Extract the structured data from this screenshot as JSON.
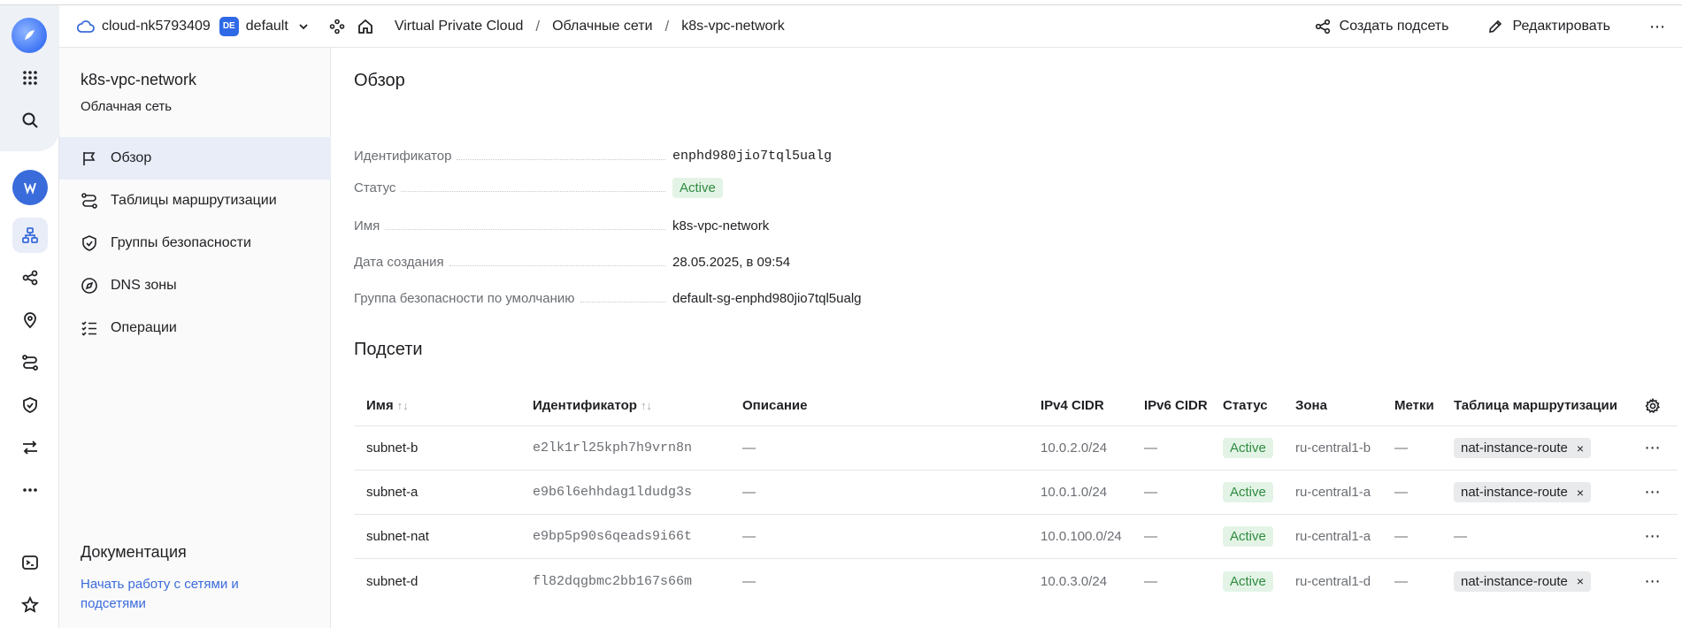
{
  "header": {
    "cloud_name": "cloud-nk5793409",
    "folder_badge": "DE",
    "folder_name": "default",
    "breadcrumb": [
      "Virtual Private Cloud",
      "Облачные сети",
      "k8s-vpc-network"
    ],
    "separator": "/",
    "create_subnet_label": "Создать подсеть",
    "edit_label": "Редактировать",
    "more_label": "⋯"
  },
  "sidebar": {
    "title": "k8s-vpc-network",
    "subtitle": "Облачная сеть",
    "items": [
      {
        "label": "Обзор",
        "icon": "flag-icon",
        "active": true
      },
      {
        "label": "Таблицы маршрутизации",
        "icon": "route-icon"
      },
      {
        "label": "Группы безопасности",
        "icon": "shield-icon"
      },
      {
        "label": "DNS зоны",
        "icon": "compass-icon"
      },
      {
        "label": "Операции",
        "icon": "list-check-icon"
      }
    ],
    "doc_title": "Документация",
    "doc_link": "Начать работу с сетями и подсетями"
  },
  "overview": {
    "title": "Обзор",
    "fields": {
      "id_label": "Идентификатор",
      "id_value": "enphd980jio7tql5ualg",
      "status_label": "Статус",
      "status_value": "Active",
      "name_label": "Имя",
      "name_value": "k8s-vpc-network",
      "created_label": "Дата создания",
      "created_value": "28.05.2025, в 09:54",
      "sg_label": "Группа безопасности по умолчанию",
      "sg_value": "default-sg-enphd980jio7tql5ualg"
    }
  },
  "subnets": {
    "title": "Подсети",
    "columns": [
      "Имя",
      "Идентификатор",
      "Описание",
      "IPv4 CIDR",
      "IPv6 CIDR",
      "Статус",
      "Зона",
      "Метки",
      "Таблица маршрутизации"
    ],
    "sort_glyph": "↑↓",
    "rows": [
      {
        "name": "subnet-b",
        "id": "e2lk1rl25kph7h9vrn8n",
        "desc": "—",
        "ipv4": "10.0.2.0/24",
        "ipv6": "—",
        "status": "Active",
        "zone": "ru-central1-b",
        "labels": "—",
        "route": "nat-instance-route",
        "route_x": "×",
        "more": "⋯"
      },
      {
        "name": "subnet-a",
        "id": "e9b6l6ehhdag1ldudg3s",
        "desc": "—",
        "ipv4": "10.0.1.0/24",
        "ipv6": "—",
        "status": "Active",
        "zone": "ru-central1-a",
        "labels": "—",
        "route": "nat-instance-route",
        "route_x": "×",
        "more": "⋯"
      },
      {
        "name": "subnet-nat",
        "id": "e9bp5p90s6qeads9i66t",
        "desc": "—",
        "ipv4": "10.0.100.0/24",
        "ipv6": "—",
        "status": "Active",
        "zone": "ru-central1-a",
        "labels": "—",
        "route_empty": "—",
        "more": "⋯"
      },
      {
        "name": "subnet-d",
        "id": "fl82dqgbmc2bb167s66m",
        "desc": "—",
        "ipv4": "10.0.3.0/24",
        "ipv6": "—",
        "status": "Active",
        "zone": "ru-central1-d",
        "labels": "—",
        "route": "nat-instance-route",
        "route_x": "×",
        "more": "⋯"
      }
    ]
  },
  "colors": {
    "accent": "#3a6bdb",
    "active_bg": "#e3f4e6",
    "active_fg": "#2f8b3f",
    "selected_nav": "#e8edf8"
  }
}
